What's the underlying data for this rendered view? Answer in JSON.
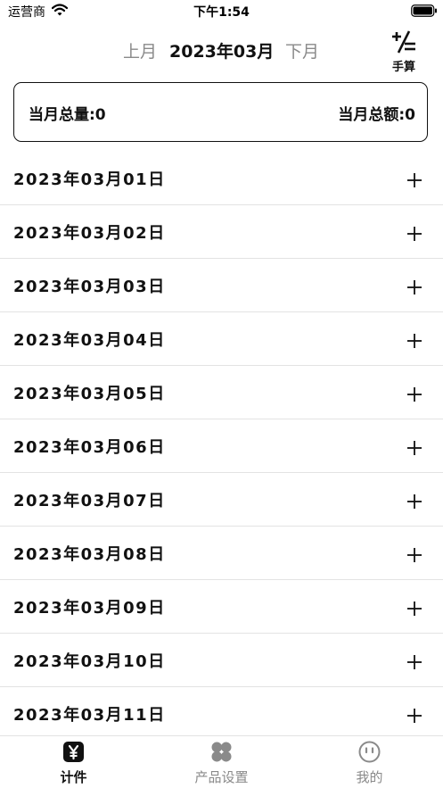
{
  "status_bar": {
    "carrier": "运营商",
    "time": "下午1:54"
  },
  "header": {
    "prev_month": "上月",
    "current_month": "2023年03月",
    "next_month": "下月",
    "calc_label": "手算"
  },
  "summary": {
    "total_quantity": "当月总量:0",
    "total_amount": "当月总额:0"
  },
  "dates": [
    "2023年03月01日",
    "2023年03月02日",
    "2023年03月03日",
    "2023年03月04日",
    "2023年03月05日",
    "2023年03月06日",
    "2023年03月07日",
    "2023年03月08日",
    "2023年03月09日",
    "2023年03月10日",
    "2023年03月11日"
  ],
  "tabs": [
    {
      "label": "计件",
      "icon": "yuan-icon",
      "active": true
    },
    {
      "label": "产品设置",
      "icon": "clover-icon",
      "active": false
    },
    {
      "label": "我的",
      "icon": "smiley-icon",
      "active": false
    }
  ],
  "colors": {
    "text": "#111111",
    "inactive": "#8a8a8a",
    "divider": "#e3e3e3"
  }
}
